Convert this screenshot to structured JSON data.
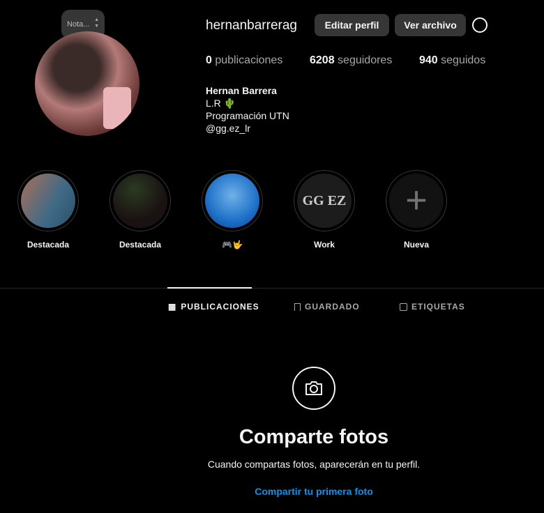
{
  "note": {
    "label": "Nota..."
  },
  "profile": {
    "username": "hernanbarrerag",
    "edit_label": "Editar perfil",
    "archive_label": "Ver archivo"
  },
  "stats": [
    {
      "value": "0",
      "label": "publicaciones"
    },
    {
      "value": "6208",
      "label": "seguidores"
    },
    {
      "value": "940",
      "label": "seguidos"
    }
  ],
  "bio": {
    "name": "Hernan Barrera",
    "line1": "L.R 🌵",
    "line2": "Programación UTN",
    "line3": "@gg.ez_lr"
  },
  "highlights": [
    {
      "label": "Destacada"
    },
    {
      "label": "Destacada"
    },
    {
      "label": "🎮🤟"
    },
    {
      "label": "Work"
    },
    {
      "label": "Nueva"
    }
  ],
  "tabs": [
    {
      "label": "PUBLICACIONES",
      "icon": "grid-icon"
    },
    {
      "label": "GUARDADO",
      "icon": "bookmark-icon"
    },
    {
      "label": "ETIQUETAS",
      "icon": "tag-user-icon"
    }
  ],
  "empty": {
    "title": "Comparte fotos",
    "subtitle": "Cuando compartas fotos, aparecerán en tu perfil.",
    "link": "Compartir tu primera foto"
  },
  "colors": {
    "link": "#0095f6",
    "button": "#363636"
  }
}
